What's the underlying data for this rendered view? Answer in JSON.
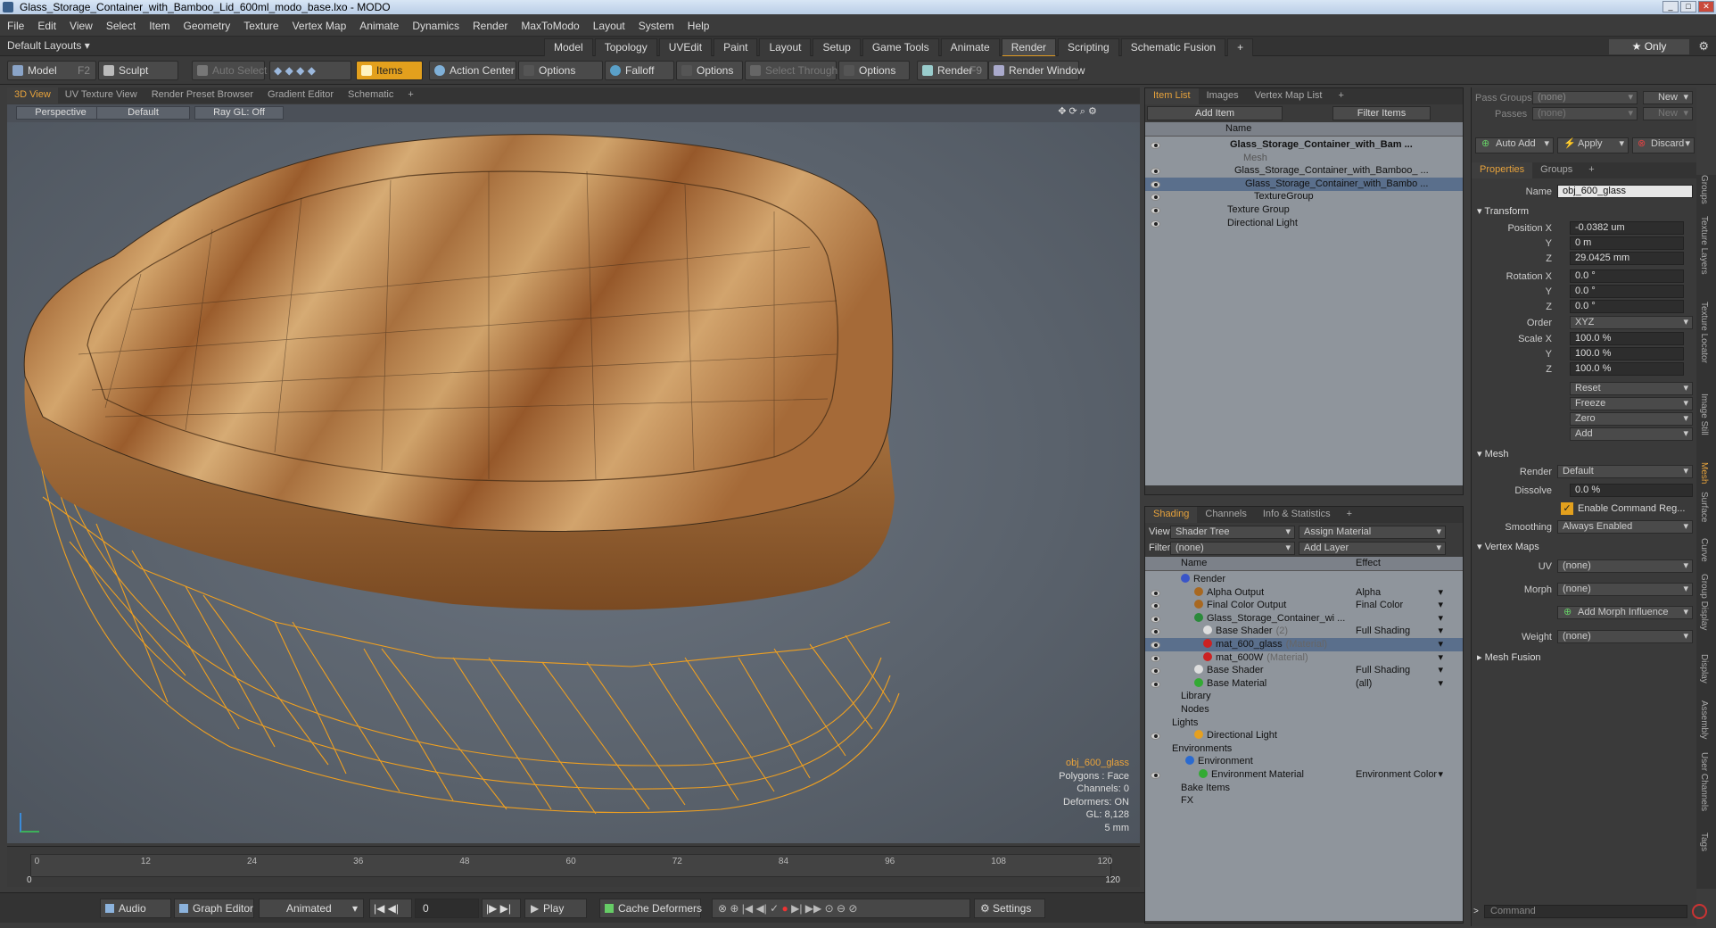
{
  "window": {
    "title": "Glass_Storage_Container_with_Bamboo_Lid_600ml_modo_base.lxo - MODO"
  },
  "menu": [
    "File",
    "Edit",
    "View",
    "Select",
    "Item",
    "Geometry",
    "Texture",
    "Vertex Map",
    "Animate",
    "Dynamics",
    "Render",
    "MaxToModo",
    "Layout",
    "System",
    "Help"
  ],
  "layout": {
    "label": "Default Layouts ▾",
    "tabs": [
      "Model",
      "Topology",
      "UVEdit",
      "Paint",
      "Layout",
      "Setup",
      "Game Tools",
      "Animate",
      "Render",
      "Scripting",
      "Schematic Fusion",
      "+"
    ],
    "active_tab": "Render",
    "only": "★ Only"
  },
  "toolbar": {
    "model": "Model",
    "model_key": "F2",
    "sculpt": "Sculpt",
    "auto_select": "Auto Select",
    "items": "Items",
    "action_center": "Action Center",
    "options1": "Options",
    "falloff": "Falloff",
    "options2": "Options",
    "select_through": "Select Through",
    "options3": "Options",
    "render": "Render",
    "render_key": "F9",
    "render_window": "Render Window"
  },
  "viewport_tabs": [
    "3D View",
    "UV Texture View",
    "Render Preset Browser",
    "Gradient Editor",
    "Schematic",
    "+"
  ],
  "viewport": {
    "perspective": "Perspective",
    "default": "Default",
    "raygl": "Ray GL: Off",
    "info": [
      "obj_600_glass",
      "Polygons : Face",
      "Channels: 0",
      "Deformers: ON",
      "GL: 8,128",
      "5 mm"
    ]
  },
  "timeline": {
    "ticks": [
      "0",
      "12",
      "24",
      "36",
      "48",
      "60",
      "72",
      "84",
      "96",
      "108",
      "120"
    ],
    "start": "0",
    "end": "120"
  },
  "playback": {
    "audio": "Audio",
    "graph_editor": "Graph Editor",
    "animated": "Animated",
    "frame": "0",
    "play": "Play",
    "cache": "Cache Deformers",
    "settings": "Settings"
  },
  "itemlist": {
    "tabs": [
      "Item List",
      "Images",
      "Vertex Map List",
      "+"
    ],
    "add_item": "Add Item",
    "filter": "Filter Items",
    "col_name": "Name",
    "rows": [
      "Glass_Storage_Container_with_Bam ...",
      "Mesh",
      "Glass_Storage_Container_with_Bamboo_ ...",
      "Glass_Storage_Container_with_Bambo ...",
      "TextureGroup",
      "Texture Group",
      "Directional Light"
    ]
  },
  "shading": {
    "tabs": [
      "Shading",
      "Channels",
      "Info & Statistics",
      "+"
    ],
    "view_label": "View",
    "view_value": "Shader Tree",
    "assign": "Assign Material",
    "filter_label": "Filter",
    "filter_value": "(none)",
    "add_layer": "Add Layer",
    "col_name": "Name",
    "col_effect": "Effect",
    "rows": [
      {
        "name": "Render",
        "effect": ""
      },
      {
        "name": "Alpha Output",
        "effect": "Alpha"
      },
      {
        "name": "Final Color Output",
        "effect": "Final Color"
      },
      {
        "name": "Glass_Storage_Container_wi ...",
        "effect": ""
      },
      {
        "name": "Base Shader",
        "suffix": "(2)",
        "effect": "Full Shading"
      },
      {
        "name": "mat_600_glass",
        "suffix": "(Material)",
        "effect": ""
      },
      {
        "name": "mat_600W",
        "suffix": "(Material)",
        "effect": ""
      },
      {
        "name": "Base Shader",
        "effect": "Full Shading"
      },
      {
        "name": "Base Material",
        "effect": "(all)"
      },
      {
        "name": "Library",
        "effect": ""
      },
      {
        "name": "Nodes",
        "effect": ""
      },
      {
        "name": "Lights",
        "effect": ""
      },
      {
        "name": "Directional Light",
        "effect": ""
      },
      {
        "name": "Environments",
        "effect": ""
      },
      {
        "name": "Environment",
        "effect": ""
      },
      {
        "name": "Environment Material",
        "effect": "Environment Color"
      },
      {
        "name": "Bake Items",
        "effect": ""
      },
      {
        "name": "FX",
        "effect": ""
      }
    ]
  },
  "properties": {
    "pass_groups": "Pass Groups",
    "passes": "Passes",
    "none": "(none)",
    "new": "New",
    "auto_add": "Auto Add",
    "apply": "Apply",
    "discard": "Discard",
    "tabs": [
      "Properties",
      "Groups",
      "+"
    ],
    "name_label": "Name",
    "name_value": "obj_600_glass",
    "transform": "Transform",
    "position_x": "Position X",
    "pos": [
      "-0.0382 um",
      "0 m",
      "29.0425 mm"
    ],
    "rotation_x": "Rotation X",
    "rot": [
      "0.0 °",
      "0.0 °",
      "0.0 °"
    ],
    "order_label": "Order",
    "order_value": "XYZ",
    "scale_x": "Scale X",
    "scale": [
      "100.0 %",
      "100.0 %",
      "100.0 %"
    ],
    "y": "Y",
    "z": "Z",
    "reset": "Reset",
    "freeze": "Freeze",
    "zero": "Zero",
    "add": "Add",
    "mesh": "Mesh",
    "render_label": "Render",
    "render_value": "Default",
    "dissolve_label": "Dissolve",
    "dissolve_value": "0.0 %",
    "enable_cmd": "Enable Command Reg...",
    "smoothing_label": "Smoothing",
    "smoothing_value": "Always Enabled",
    "vertex_maps": "Vertex Maps",
    "uv_label": "UV",
    "morph_label": "Morph",
    "add_morph": "Add Morph Influence",
    "weight_label": "Weight",
    "mesh_fusion": "Mesh Fusion",
    "command": "Command"
  },
  "side_tabs": [
    "Groups",
    "Texture Layers",
    "Texture Locator",
    "Image Still",
    "Mesh",
    "Surface",
    "Curve",
    "Group Display",
    "Display",
    "Assembly",
    "User Channels",
    "Tags"
  ]
}
